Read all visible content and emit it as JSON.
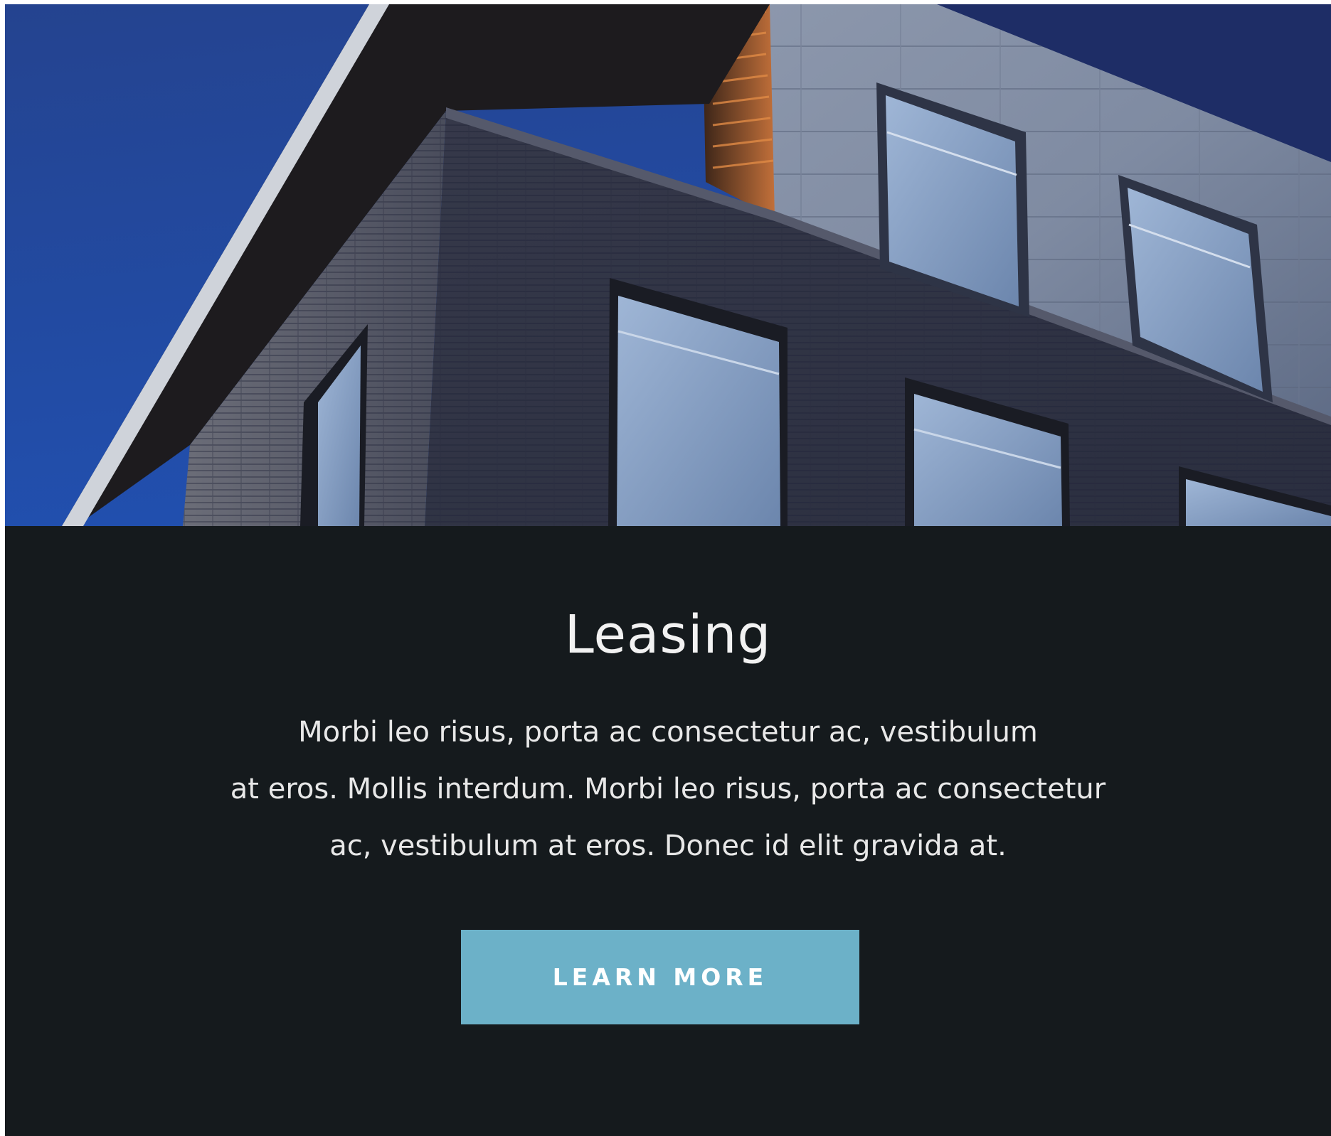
{
  "hero": {
    "image_label": "building-photo"
  },
  "content": {
    "title": "Leasing",
    "body_lines": [
      "Morbi leo risus, porta ac consectetur ac, vestibulum",
      "at eros. Mollis interdum. Morbi leo risus, porta ac consectetur",
      "ac, vestibulum at eros. Donec id elit gravida at."
    ],
    "cta_label": "LEARN MORE"
  },
  "colors": {
    "panel_bg": "#151a1d",
    "cta_bg": "#6cb1c8",
    "sky": "#2347a3",
    "text": "#f2f2f2"
  }
}
